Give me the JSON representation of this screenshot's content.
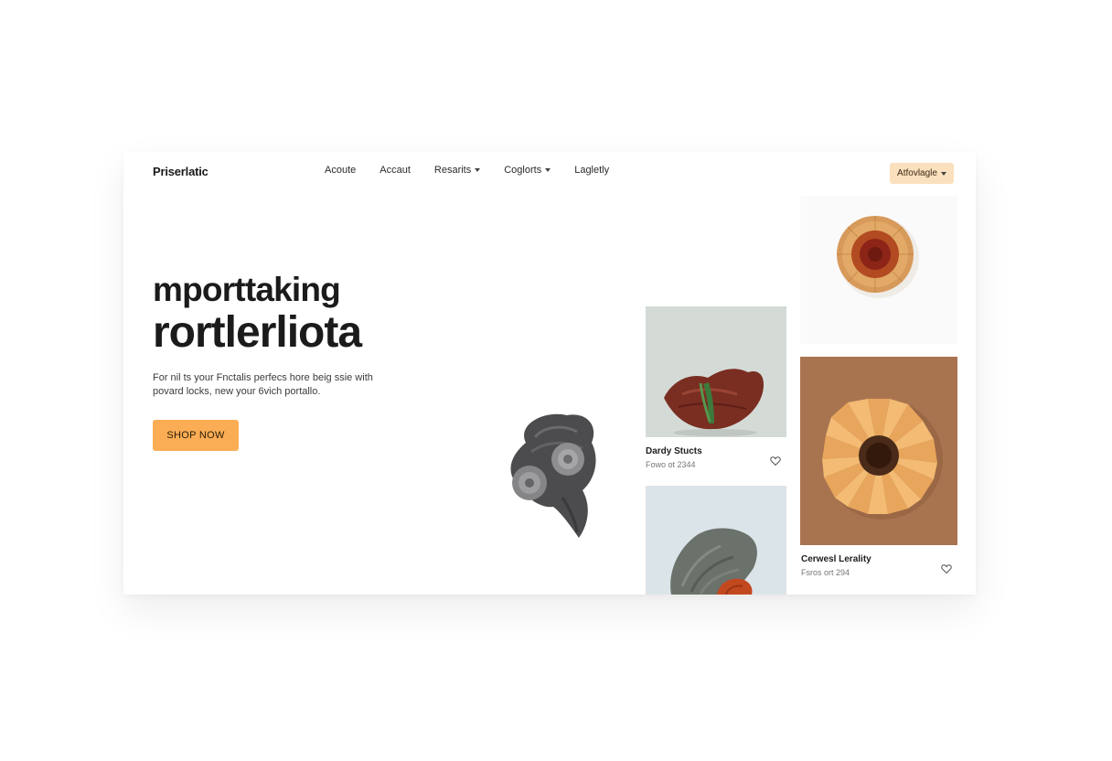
{
  "brand": {
    "logo": "Priserlatic"
  },
  "nav": {
    "items": [
      {
        "label": "Acoute",
        "has_dropdown": false
      },
      {
        "label": "Accaut",
        "has_dropdown": false
      },
      {
        "label": "Resarits",
        "has_dropdown": true
      },
      {
        "label": "Coglorts",
        "has_dropdown": true
      },
      {
        "label": "Lagletly",
        "has_dropdown": false
      }
    ],
    "cta_label": "Atfovlagle"
  },
  "hero": {
    "line1": "mporttaking",
    "line2": "rortlerliota",
    "description": "For nil ts your Fnctalis perfecs hore beig ssie with povard locks, new your 6vich portallo.",
    "button_label": "SHOP NOW"
  },
  "cards": [
    {
      "title": "Dardy Stucts",
      "subtitle": "Fowo ot 2344"
    },
    {
      "title": "Cerwesl Lerality",
      "subtitle": "Fsros ort 294"
    }
  ],
  "colors": {
    "accent": "#fbad55",
    "accent_soft": "#fbe0bd",
    "text": "#1b1b1b",
    "card_brown": "#a97550"
  },
  "icons": [
    "chevron-down-icon",
    "heart-icon"
  ]
}
